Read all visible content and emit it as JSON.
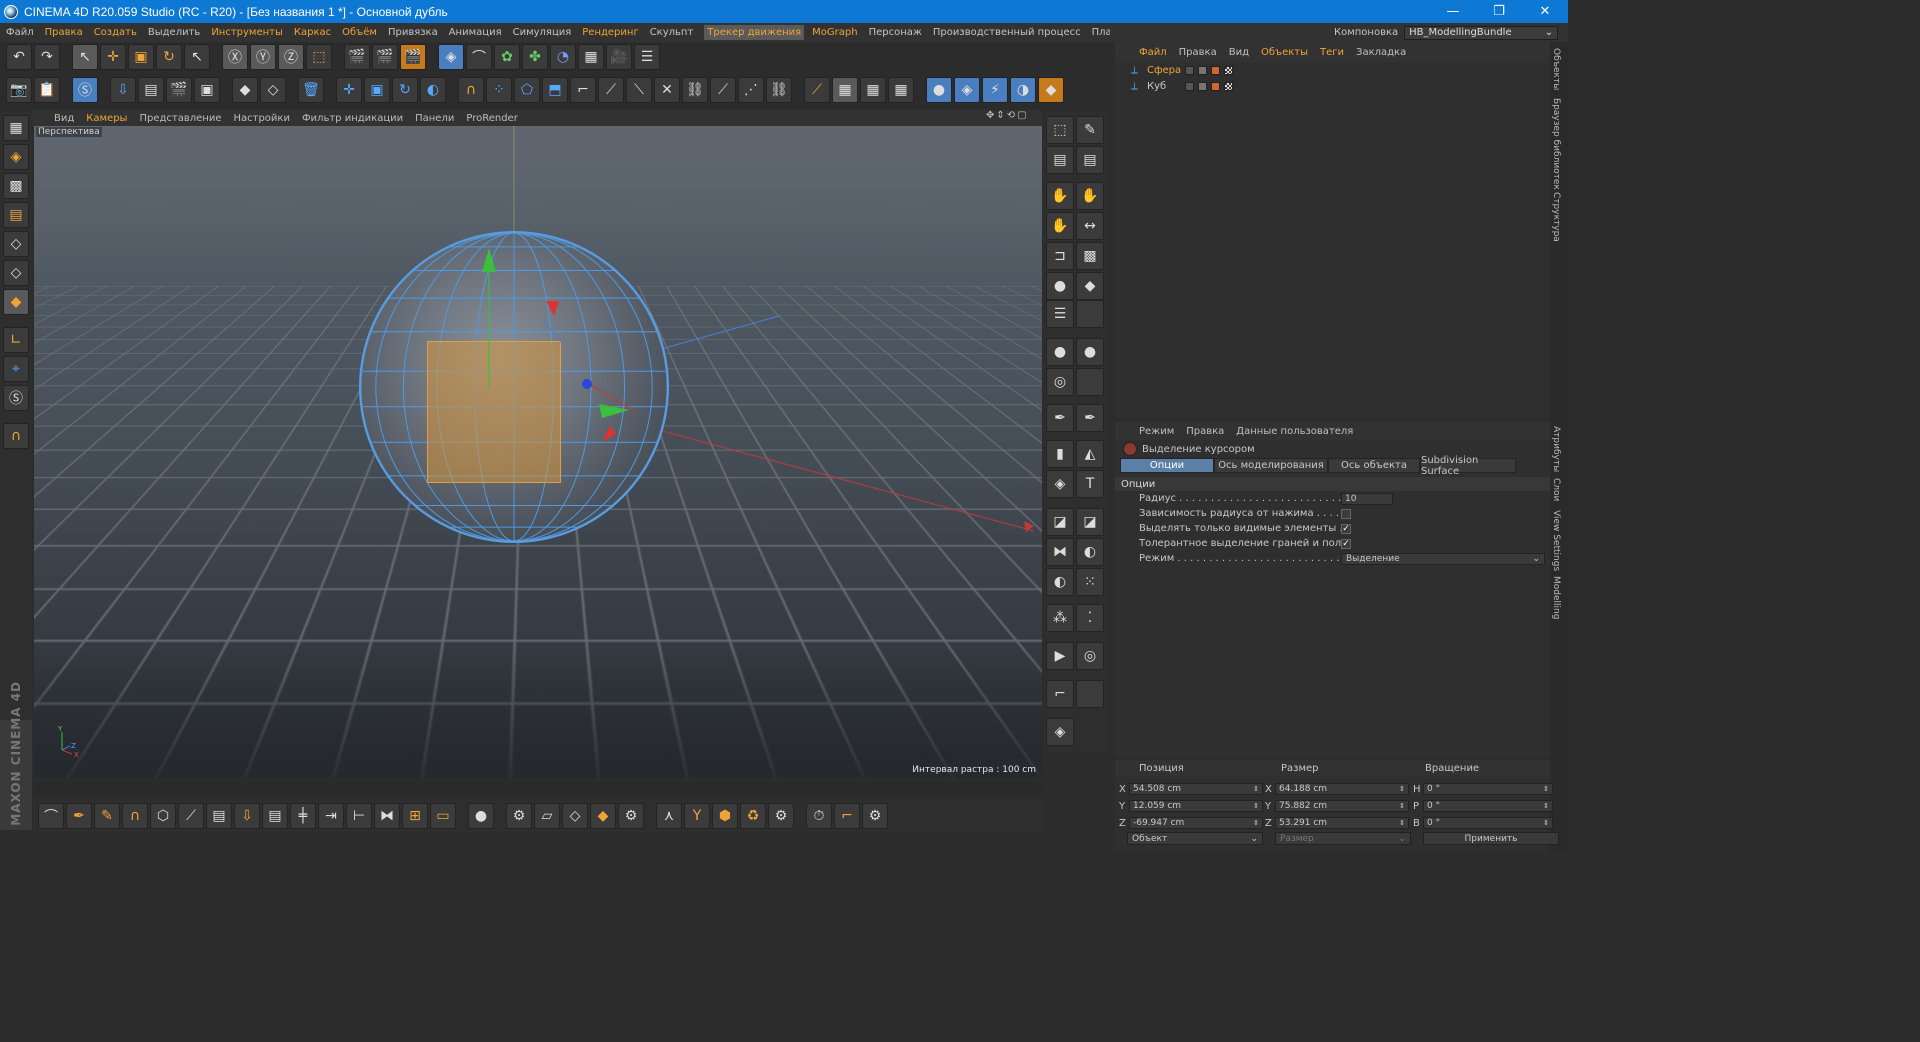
{
  "title": "CINEMA 4D R20.059 Studio (RC - R20) - [Без названия 1 *] - Основной дубль",
  "menu": [
    {
      "label": "Файл",
      "hl": false
    },
    {
      "label": "Правка",
      "hl": true
    },
    {
      "label": "Создать",
      "hl": true
    },
    {
      "label": "Выделить",
      "hl": false
    },
    {
      "label": "Инструменты",
      "hl": true
    },
    {
      "label": "Каркас",
      "hl": true
    },
    {
      "label": "Объём",
      "hl": true
    },
    {
      "label": "Привязка",
      "hl": false
    },
    {
      "label": "Анимация",
      "hl": false
    },
    {
      "label": "Симуляция",
      "hl": false
    },
    {
      "label": "Рендеринг",
      "hl": true
    },
    {
      "label": "Скульпт",
      "hl": false
    },
    {
      "label": "Трекер движения",
      "hl": true,
      "active": true
    },
    {
      "label": "MoGraph",
      "hl": true
    },
    {
      "label": "Персонаж",
      "hl": false
    },
    {
      "label": "Производственный процесс",
      "hl": false
    },
    {
      "label": "Плагины",
      "hl": false
    },
    {
      "label": "Скрипт",
      "hl": true
    },
    {
      "label": "Окно",
      "hl": true
    },
    {
      "label": "Справка",
      "hl": false
    }
  ],
  "layout": {
    "label": "Компоновка",
    "value": "HB_ModellingBundle"
  },
  "viewport": {
    "menu": [
      {
        "label": "Вид",
        "hl": false
      },
      {
        "label": "Камеры",
        "hl": true
      },
      {
        "label": "Представление",
        "hl": false
      },
      {
        "label": "Настройки",
        "hl": false
      },
      {
        "label": "Фильтр индикации",
        "hl": false
      },
      {
        "label": "Панели",
        "hl": false
      },
      {
        "label": "ProRender",
        "hl": false
      }
    ],
    "name": "Перспектива",
    "interval": "Интервал растра : 100 cm"
  },
  "maxon": "MAXON CINEMA 4D",
  "objects": {
    "menu": [
      {
        "label": "Файл",
        "hl": true
      },
      {
        "label": "Правка",
        "hl": false
      },
      {
        "label": "Вид",
        "hl": false
      },
      {
        "label": "Объекты",
        "hl": true
      },
      {
        "label": "Теги",
        "hl": true
      },
      {
        "label": "Закладка",
        "hl": false
      }
    ],
    "items": [
      {
        "name": "Сфера",
        "selected": true
      },
      {
        "name": "Куб",
        "selected": false
      }
    ]
  },
  "sidetabs": [
    "Объекты",
    "Браузер библиотек",
    "Структура",
    "Атрибуты",
    "Слои",
    "View Settings",
    "Modelling"
  ],
  "attributes": {
    "menu": [
      "Режим",
      "Правка",
      "Данные пользователя"
    ],
    "tool": "Выделение курсором",
    "tabs": [
      {
        "label": "Опции",
        "active": true
      },
      {
        "label": "Ось моделирования",
        "active": false
      },
      {
        "label": "Ось объекта",
        "active": false
      },
      {
        "label": "Subdivision Surface",
        "active": false
      }
    ],
    "section": "Опции",
    "rows": [
      {
        "label": "Радиус . . . . . . . . . . . . . . . . . . . . . . . . . . . . . . . .",
        "kind": "num",
        "value": "10"
      },
      {
        "label": "Зависимость радиуса от нажима . . . . . . . . . . . .",
        "kind": "chk",
        "value": ""
      },
      {
        "label": "Выделять только видимые элементы . . . . . . . . .",
        "kind": "chk",
        "value": "✓"
      },
      {
        "label": "Толерантное выделение граней и полигонов",
        "kind": "chk",
        "value": "✓"
      },
      {
        "label": "Режим . . . . . . . . . . . . . . . . . . . . . . . . . . . . . . . . .",
        "kind": "dd",
        "value": "Выделение"
      }
    ]
  },
  "coords": {
    "headers": [
      "Позиция",
      "Размер",
      "Вращение"
    ],
    "rows": [
      {
        "a": "X",
        "av": "54.508 cm",
        "b": "X",
        "bv": "64.188 cm",
        "c": "H",
        "cv": "0 °"
      },
      {
        "a": "Y",
        "av": "12.059 cm",
        "b": "Y",
        "bv": "75.882 cm",
        "c": "P",
        "cv": "0 °"
      },
      {
        "a": "Z",
        "av": "-69.947 cm",
        "b": "Z",
        "bv": "53.291 cm",
        "c": "B",
        "cv": "0 °"
      }
    ],
    "mode": "Объект",
    "size": "Размер",
    "apply": "Применить"
  }
}
